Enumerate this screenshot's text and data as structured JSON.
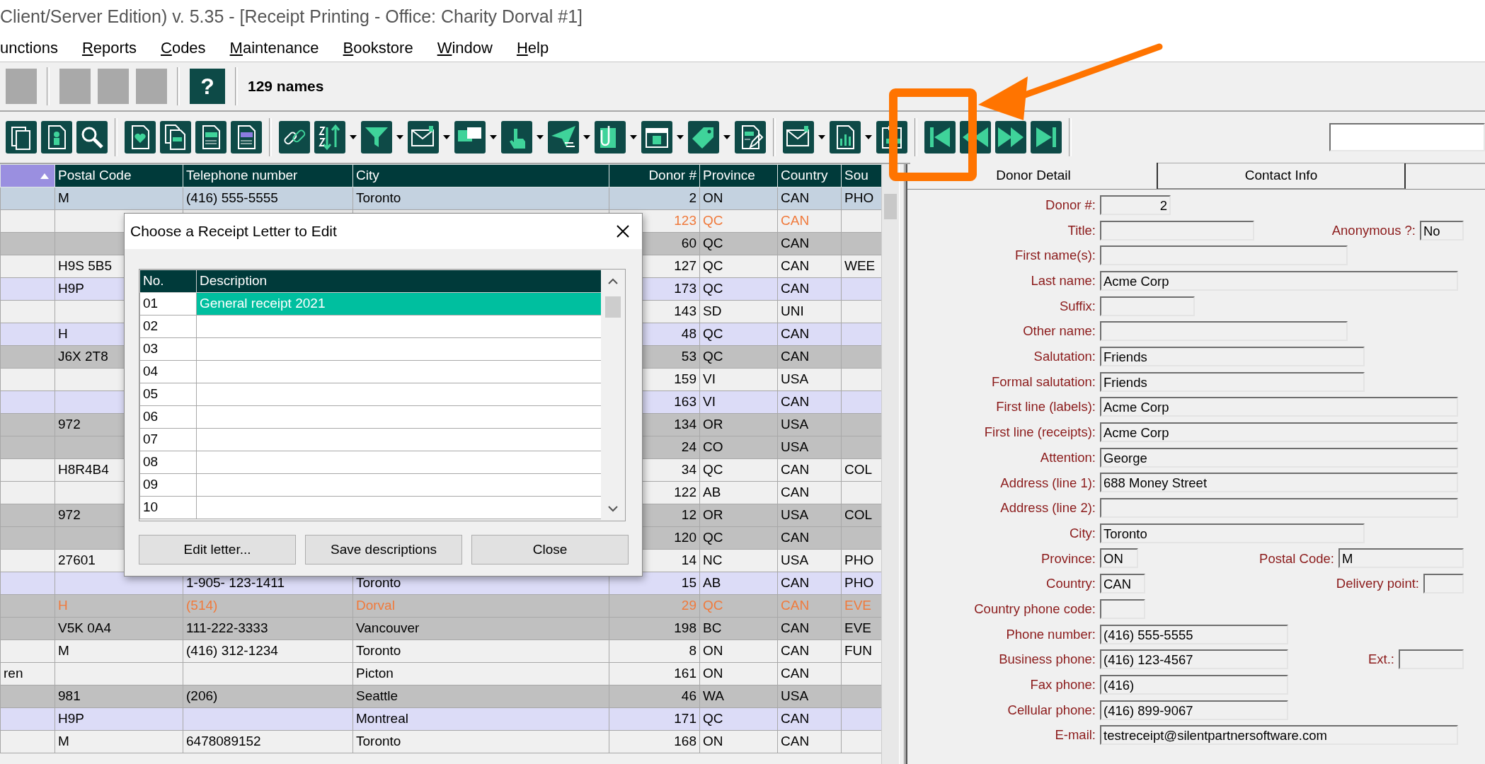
{
  "window": {
    "title": "Client/Server Edition) v. 5.35 - [Receipt Printing - Office: Charity Dorval #1]"
  },
  "menu": [
    {
      "label": "unctions",
      "access_key": false
    },
    {
      "label": "Reports",
      "access_key": true
    },
    {
      "label": "Codes",
      "access_key": true
    },
    {
      "label": "Maintenance",
      "access_key": true
    },
    {
      "label": "Bookstore",
      "access_key": true
    },
    {
      "label": "Window",
      "access_key": true
    },
    {
      "label": "Help",
      "access_key": true
    }
  ],
  "toolbar": {
    "help_label": "?",
    "count": "129 names"
  },
  "grid": {
    "columns": [
      {
        "sorted": true
      },
      {
        "label": "Postal Code",
        "sorted": false
      },
      {
        "label": "Telephone number",
        "sorted": false
      },
      {
        "label": "City",
        "sorted": false
      },
      {
        "label": "Donor #",
        "sorted": false
      },
      {
        "label": "Province",
        "sorted": false
      },
      {
        "label": "Country",
        "sorted": false
      },
      {
        "label": "Sou",
        "sorted": false
      }
    ],
    "rows": [
      {
        "selected": true,
        "flagged": false,
        "cells": [
          null,
          "M",
          "(416) 555-5555",
          "Toronto",
          "2",
          "ON",
          "CAN",
          "PHO"
        ]
      },
      {
        "selected": false,
        "color": "#f0f0f0",
        "flagged": true,
        "cells": [
          null,
          null,
          null,
          null,
          "123",
          "QC",
          "CAN",
          null
        ]
      },
      {
        "selected": false,
        "color": "#c0c0c0",
        "flagged": false,
        "cells": [
          null,
          null,
          null,
          null,
          "60",
          "QC",
          "CAN",
          null
        ]
      },
      {
        "selected": false,
        "color": "#f0f0f0",
        "flagged": false,
        "cells": [
          null,
          "H9S 5B5",
          null,
          null,
          "127",
          "QC",
          "CAN",
          "WEE"
        ]
      },
      {
        "selected": false,
        "color": "#dcdcf7",
        "flagged": false,
        "cells": [
          null,
          "H9P",
          null,
          null,
          "173",
          "QC",
          "CAN",
          null
        ]
      },
      {
        "selected": false,
        "color": "#f0f0f0",
        "flagged": false,
        "cells": [
          null,
          null,
          null,
          null,
          "143",
          "SD",
          "UNI",
          null
        ]
      },
      {
        "selected": false,
        "color": "#dcdcf7",
        "flagged": false,
        "cells": [
          null,
          "H",
          null,
          null,
          "48",
          "QC",
          "CAN",
          null
        ]
      },
      {
        "selected": false,
        "color": "#c0c0c0",
        "flagged": false,
        "cells": [
          null,
          "J6X 2T8",
          null,
          null,
          "53",
          "QC",
          "CAN",
          null
        ]
      },
      {
        "selected": false,
        "color": "#f0f0f0",
        "flagged": false,
        "cells": [
          null,
          null,
          null,
          null,
          "159",
          "VI",
          "USA",
          null
        ]
      },
      {
        "selected": false,
        "color": "#dcdcf7",
        "flagged": false,
        "cells": [
          null,
          null,
          null,
          null,
          "163",
          "VI",
          "CAN",
          null
        ]
      },
      {
        "selected": false,
        "color": "#c0c0c0",
        "flagged": false,
        "cells": [
          null,
          "972",
          null,
          null,
          "134",
          "OR",
          "USA",
          null
        ]
      },
      {
        "selected": false,
        "color": "#c0c0c0",
        "flagged": false,
        "cells": [
          null,
          null,
          null,
          null,
          "24",
          "CO",
          "USA",
          null
        ]
      },
      {
        "selected": false,
        "color": "#f0f0f0",
        "flagged": false,
        "cells": [
          null,
          "H8R4B4",
          null,
          null,
          "34",
          "QC",
          "CAN",
          "COL"
        ]
      },
      {
        "selected": false,
        "color": "#f0f0f0",
        "flagged": false,
        "cells": [
          null,
          null,
          null,
          null,
          "122",
          "AB",
          "CAN",
          null
        ]
      },
      {
        "selected": false,
        "color": "#c0c0c0",
        "flagged": false,
        "cells": [
          null,
          "972",
          null,
          null,
          "12",
          "OR",
          "USA",
          "COL"
        ]
      },
      {
        "selected": false,
        "color": "#c0c0c0",
        "flagged": false,
        "cells": [
          null,
          null,
          null,
          null,
          "120",
          "QC",
          "CAN",
          null
        ]
      },
      {
        "selected": false,
        "color": "#f0f0f0",
        "flagged": false,
        "cells": [
          null,
          "27601",
          null,
          null,
          "14",
          "NC",
          "USA",
          "PHO"
        ]
      },
      {
        "selected": false,
        "color": "#dcdcf7",
        "flagged": false,
        "cells": [
          null,
          null,
          "1-905- 123-1411",
          "Toronto",
          "15",
          "AB",
          "CAN",
          "PHO"
        ]
      },
      {
        "selected": false,
        "color": "#c0c0c0",
        "flagged": true,
        "cells": [
          null,
          "H",
          "(514)",
          "Dorval",
          "29",
          "QC",
          "CAN",
          "EVE"
        ]
      },
      {
        "selected": false,
        "color": "#c0c0c0",
        "flagged": false,
        "cells": [
          null,
          "V5K 0A4",
          "111-222-3333",
          "Vancouver",
          "198",
          "BC",
          "CAN",
          "EVE"
        ]
      },
      {
        "selected": false,
        "color": "#f0f0f0",
        "flagged": false,
        "cells": [
          null,
          "M",
          "(416) 312-1234",
          "Toronto",
          "8",
          "ON",
          "CAN",
          "FUN"
        ]
      },
      {
        "selected": false,
        "color": "#f0f0f0",
        "flagged": false,
        "cells": [
          "ren",
          null,
          null,
          "Picton",
          "161",
          "ON",
          "CAN",
          null
        ]
      },
      {
        "selected": false,
        "color": "#c0c0c0",
        "flagged": false,
        "cells": [
          null,
          "981",
          "(206)",
          "Seattle",
          "46",
          "WA",
          "USA",
          null
        ]
      },
      {
        "selected": false,
        "color": "#dcdcf7",
        "flagged": false,
        "cells": [
          null,
          "H9P",
          null,
          "Montreal",
          "171",
          "QC",
          "CAN",
          null
        ]
      },
      {
        "selected": false,
        "color": "#f0f0f0",
        "flagged": false,
        "cells": [
          null,
          "M",
          "6478089152",
          "Toronto",
          "168",
          "ON",
          "CAN",
          null
        ]
      }
    ]
  },
  "dialog": {
    "title": "Choose a Receipt Letter to Edit",
    "columns": [
      "No.",
      "Description"
    ],
    "rows": [
      {
        "no": "01",
        "description": "General receipt 2021",
        "selected": true
      },
      {
        "no": "02",
        "selected": false
      },
      {
        "no": "03",
        "selected": false
      },
      {
        "no": "04",
        "selected": false
      },
      {
        "no": "05",
        "selected": false
      },
      {
        "no": "06",
        "selected": false
      },
      {
        "no": "07",
        "selected": false
      },
      {
        "no": "08",
        "selected": false
      },
      {
        "no": "09",
        "selected": false
      },
      {
        "no": "10",
        "selected": false
      }
    ],
    "buttons": [
      "Edit letter...",
      "Save descriptions",
      "Close"
    ]
  },
  "tabs": [
    {
      "label": "Donor Detail",
      "selected": true
    },
    {
      "label": "Contact Info",
      "selected": false
    }
  ],
  "fields": [
    {
      "label": "Donor #:",
      "value": "2"
    },
    {
      "label": "Title:",
      "right_field": {
        "label": "Anonymous ?:",
        "value": "No"
      }
    },
    {
      "label": "First name(s):"
    },
    {
      "label": "Last name:",
      "value": "Acme Corp"
    },
    {
      "label": "Suffix:"
    },
    {
      "label": "Other name:"
    },
    {
      "label": "Salutation:",
      "value": "Friends"
    },
    {
      "label": "Formal salutation:",
      "value": "Friends"
    },
    {
      "label": "First line (labels):",
      "value": "Acme Corp"
    },
    {
      "label": "First line (receipts):",
      "value": "Acme Corp"
    },
    {
      "label": "Attention:",
      "value": "George"
    },
    {
      "label": "Address (line 1):",
      "value": "688 Money Street"
    },
    {
      "label": "Address (line 2):"
    },
    {
      "label": "City:",
      "value": "Toronto"
    },
    {
      "label": "Province:",
      "value": "ON",
      "right_field": {
        "label": "Postal Code:",
        "value": "M"
      }
    },
    {
      "label": "Country:",
      "value": "CAN",
      "right_field": {
        "label": "Delivery point:"
      }
    },
    {
      "label": "Country phone code:"
    },
    {
      "label": "Phone number:",
      "value": "(416) 555-5555"
    },
    {
      "label": "Business phone:",
      "value": "(416) 123-4567",
      "right_field": {
        "label": "Ext.:"
      }
    },
    {
      "label": "Fax phone:",
      "value": "(416)"
    },
    {
      "label": "Cellular phone:",
      "value": "(416) 899-9067"
    },
    {
      "label": "E-mail:",
      "value": "testreceipt@silentpartnersoftware.com"
    }
  ]
}
